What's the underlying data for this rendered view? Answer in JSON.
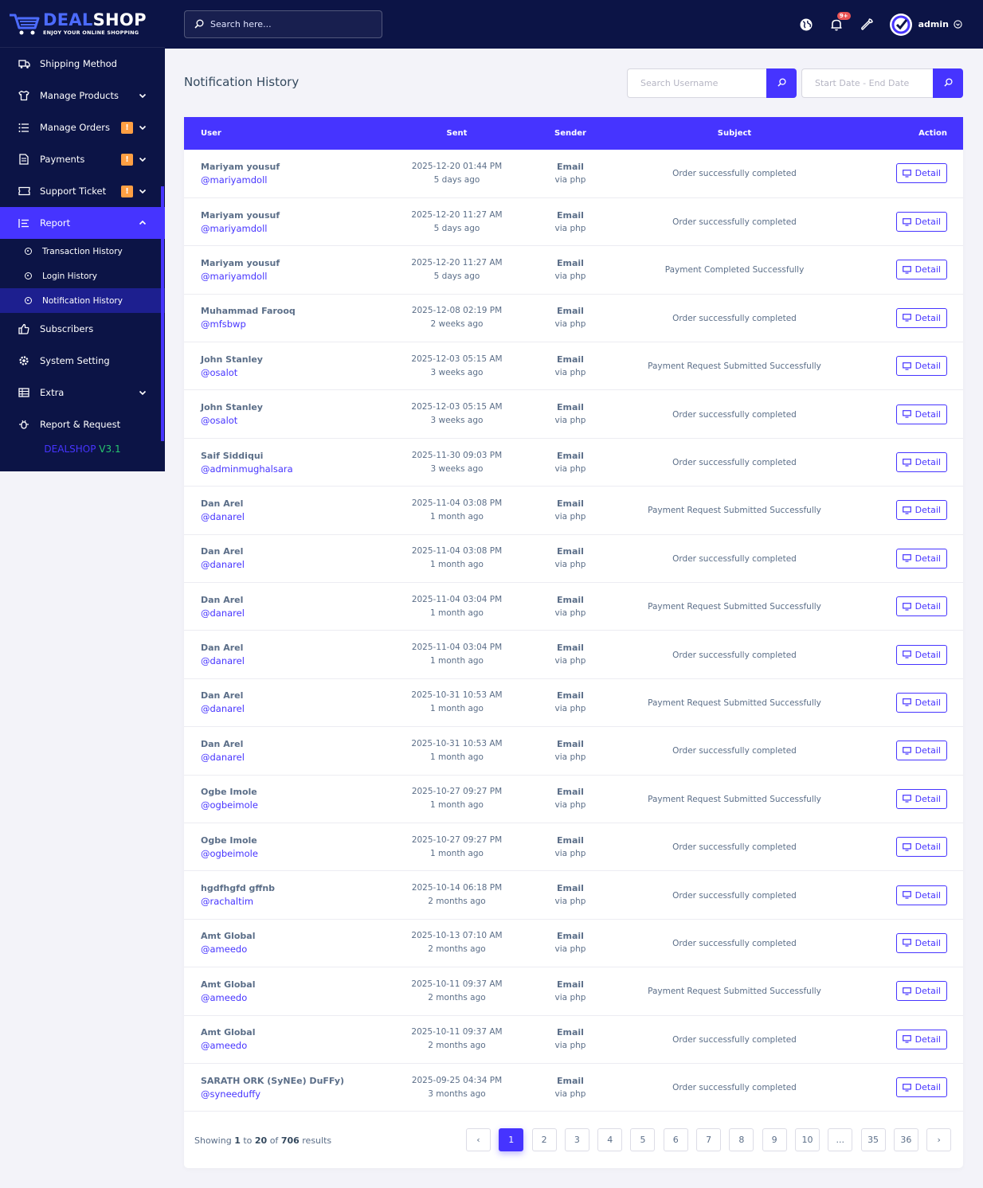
{
  "brand": {
    "name_a": "DEAL",
    "name_b": "SHOP",
    "tagline": "ENJOY YOUR ONLINE SHOPPING",
    "version_a": "DEALSHOP ",
    "version_b": "V3.1"
  },
  "topbar": {
    "search_placeholder": "Search here...",
    "notif_badge": "9+",
    "user": "admin"
  },
  "sidebar": {
    "items": [
      {
        "label": "Shipping Method"
      },
      {
        "label": "Manage Products"
      },
      {
        "label": "Manage Orders"
      },
      {
        "label": "Payments"
      },
      {
        "label": "Support Ticket"
      },
      {
        "label": "Report"
      },
      {
        "label": "Subscribers"
      },
      {
        "label": "System Setting"
      },
      {
        "label": "Extra"
      },
      {
        "label": "Report & Request"
      }
    ],
    "warn": "!",
    "report_sub": [
      {
        "label": "Transaction History"
      },
      {
        "label": "Login History"
      },
      {
        "label": "Notification History"
      }
    ]
  },
  "page": {
    "title": "Notification History",
    "search_user_placeholder": "Search Username",
    "date_placeholder": "Start Date - End Date"
  },
  "table": {
    "headers": {
      "user": "User",
      "sent": "Sent",
      "sender": "Sender",
      "subject": "Subject",
      "action": "Action"
    },
    "detail_label": "Detail",
    "rows": [
      {
        "name": "Mariyam yousuf",
        "handle": "@mariyamdoll",
        "date": "2025-12-20 01:44 PM",
        "ago": "5 days ago",
        "sender": "Email",
        "via": "via php",
        "subject": "Order successfully completed"
      },
      {
        "name": "Mariyam yousuf",
        "handle": "@mariyamdoll",
        "date": "2025-12-20 11:27 AM",
        "ago": "5 days ago",
        "sender": "Email",
        "via": "via php",
        "subject": "Order successfully completed"
      },
      {
        "name": "Mariyam yousuf",
        "handle": "@mariyamdoll",
        "date": "2025-12-20 11:27 AM",
        "ago": "5 days ago",
        "sender": "Email",
        "via": "via php",
        "subject": "Payment Completed Successfully"
      },
      {
        "name": "Muhammad Farooq",
        "handle": "@mfsbwp",
        "date": "2025-12-08 02:19 PM",
        "ago": "2 weeks ago",
        "sender": "Email",
        "via": "via php",
        "subject": "Order successfully completed"
      },
      {
        "name": "John Stanley",
        "handle": "@osalot",
        "date": "2025-12-03 05:15 AM",
        "ago": "3 weeks ago",
        "sender": "Email",
        "via": "via php",
        "subject": "Payment Request Submitted Successfully"
      },
      {
        "name": "John Stanley",
        "handle": "@osalot",
        "date": "2025-12-03 05:15 AM",
        "ago": "3 weeks ago",
        "sender": "Email",
        "via": "via php",
        "subject": "Order successfully completed"
      },
      {
        "name": "Saif Siddiqui",
        "handle": "@adminmughalsara",
        "date": "2025-11-30 09:03 PM",
        "ago": "3 weeks ago",
        "sender": "Email",
        "via": "via php",
        "subject": "Order successfully completed"
      },
      {
        "name": "Dan Arel",
        "handle": "@danarel",
        "date": "2025-11-04 03:08 PM",
        "ago": "1 month ago",
        "sender": "Email",
        "via": "via php",
        "subject": "Payment Request Submitted Successfully"
      },
      {
        "name": "Dan Arel",
        "handle": "@danarel",
        "date": "2025-11-04 03:08 PM",
        "ago": "1 month ago",
        "sender": "Email",
        "via": "via php",
        "subject": "Order successfully completed"
      },
      {
        "name": "Dan Arel",
        "handle": "@danarel",
        "date": "2025-11-04 03:04 PM",
        "ago": "1 month ago",
        "sender": "Email",
        "via": "via php",
        "subject": "Payment Request Submitted Successfully"
      },
      {
        "name": "Dan Arel",
        "handle": "@danarel",
        "date": "2025-11-04 03:04 PM",
        "ago": "1 month ago",
        "sender": "Email",
        "via": "via php",
        "subject": "Order successfully completed"
      },
      {
        "name": "Dan Arel",
        "handle": "@danarel",
        "date": "2025-10-31 10:53 AM",
        "ago": "1 month ago",
        "sender": "Email",
        "via": "via php",
        "subject": "Payment Request Submitted Successfully"
      },
      {
        "name": "Dan Arel",
        "handle": "@danarel",
        "date": "2025-10-31 10:53 AM",
        "ago": "1 month ago",
        "sender": "Email",
        "via": "via php",
        "subject": "Order successfully completed"
      },
      {
        "name": "Ogbe Imole",
        "handle": "@ogbeimole",
        "date": "2025-10-27 09:27 PM",
        "ago": "1 month ago",
        "sender": "Email",
        "via": "via php",
        "subject": "Payment Request Submitted Successfully"
      },
      {
        "name": "Ogbe Imole",
        "handle": "@ogbeimole",
        "date": "2025-10-27 09:27 PM",
        "ago": "1 month ago",
        "sender": "Email",
        "via": "via php",
        "subject": "Order successfully completed"
      },
      {
        "name": "hgdfhgfd gffnb",
        "handle": "@rachaltim",
        "date": "2025-10-14 06:18 PM",
        "ago": "2 months ago",
        "sender": "Email",
        "via": "via php",
        "subject": "Order successfully completed"
      },
      {
        "name": "Amt Global",
        "handle": "@ameedo",
        "date": "2025-10-13 07:10 AM",
        "ago": "2 months ago",
        "sender": "Email",
        "via": "via php",
        "subject": "Order successfully completed"
      },
      {
        "name": "Amt Global",
        "handle": "@ameedo",
        "date": "2025-10-11 09:37 AM",
        "ago": "2 months ago",
        "sender": "Email",
        "via": "via php",
        "subject": "Payment Request Submitted Successfully"
      },
      {
        "name": "Amt Global",
        "handle": "@ameedo",
        "date": "2025-10-11 09:37 AM",
        "ago": "2 months ago",
        "sender": "Email",
        "via": "via php",
        "subject": "Order successfully completed"
      },
      {
        "name": "SARATH ORK (SyNEe) DuFFy)",
        "handle": "@syneeduffy",
        "date": "2025-09-25 04:34 PM",
        "ago": "3 months ago",
        "sender": "Email",
        "via": "via php",
        "subject": "Order successfully completed"
      }
    ]
  },
  "footer": {
    "showing_pre": "Showing ",
    "from": "1",
    "to_word": " to ",
    "to": "20",
    "of_word": " of ",
    "total": "706",
    "results_word": " results",
    "pages": [
      "‹",
      "1",
      "2",
      "3",
      "4",
      "5",
      "6",
      "7",
      "8",
      "9",
      "10",
      "...",
      "35",
      "36",
      "›"
    ],
    "active_page": "1"
  },
  "colors": {
    "primary": "#4634ff",
    "navy": "#0c1446",
    "warning": "#ff9f43"
  }
}
